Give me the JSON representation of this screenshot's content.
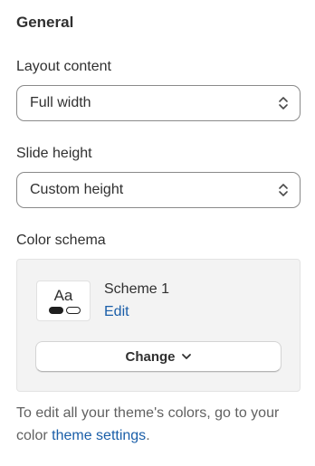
{
  "section": {
    "title": "General"
  },
  "layout_content": {
    "label": "Layout content",
    "value": "Full width"
  },
  "slide_height": {
    "label": "Slide height",
    "value": "Custom height"
  },
  "color_schema": {
    "label": "Color schema",
    "preview_text": "Aa",
    "scheme_name": "Scheme 1",
    "edit_label": "Edit",
    "change_label": "Change"
  },
  "help": {
    "text_before": "To edit all your theme's colors, go to your color ",
    "link_text": "theme settings",
    "text_after": "."
  },
  "colors": {
    "link": "#1a5ea8",
    "text": "#303030",
    "muted_text": "#616161",
    "card_background": "#f3f3f3"
  },
  "icons": {
    "select_indicator": "chevron-up-down-icon",
    "change_indicator": "chevron-down-icon"
  }
}
